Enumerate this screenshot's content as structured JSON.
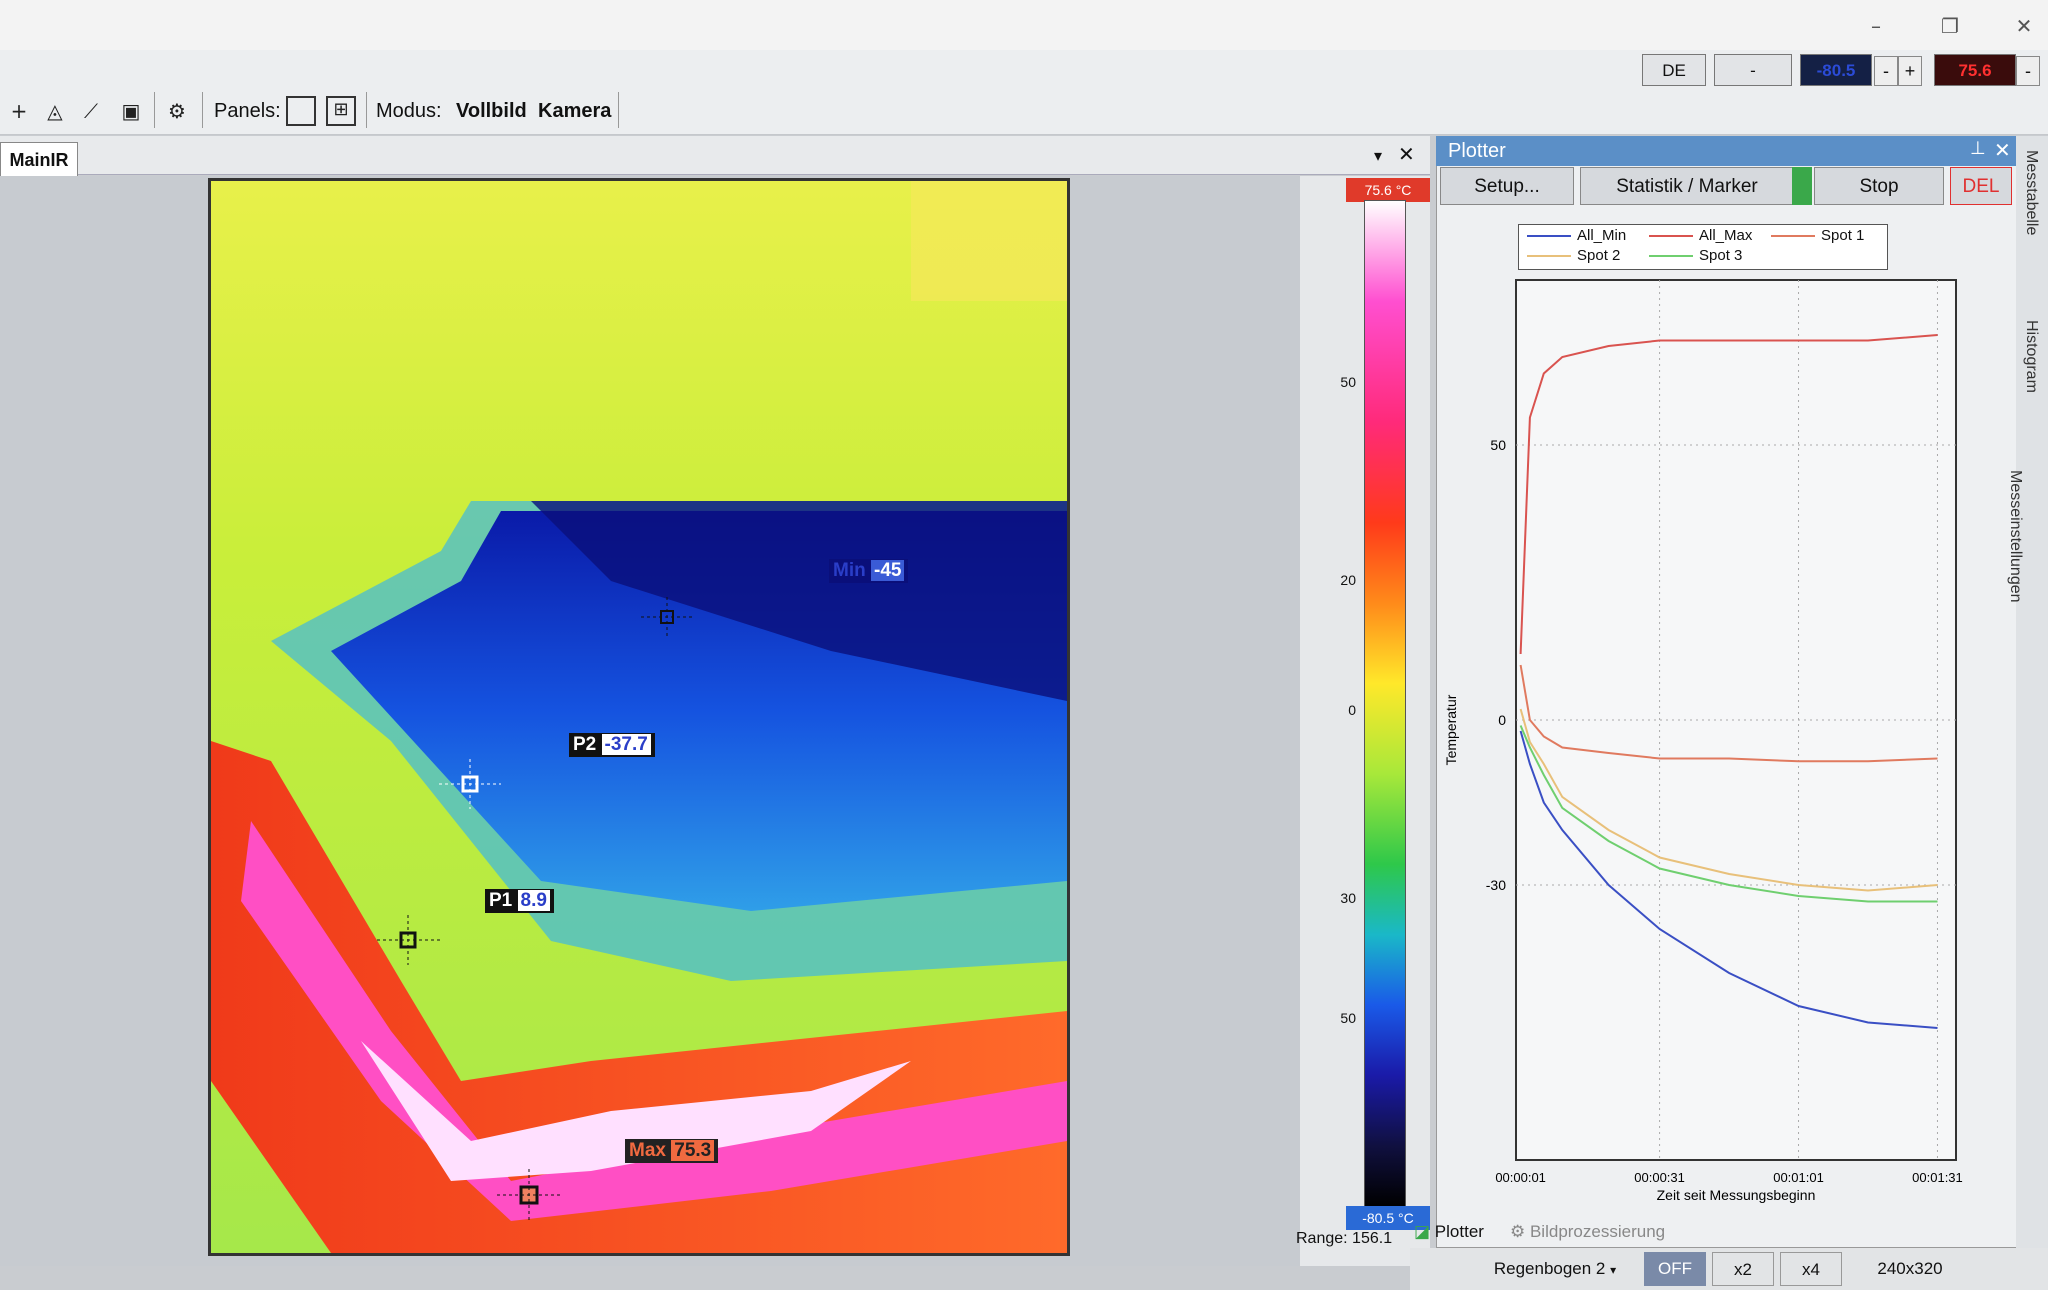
{
  "window": {
    "minimize": "–",
    "restore": "❐",
    "close": "✕"
  },
  "toolbar": {
    "panels_label": "Panels:",
    "modus_label": "Modus:",
    "modus_options": [
      "Vollbild",
      "Kamera"
    ],
    "lang": "DE",
    "dash": "-",
    "min_value": "-80.5",
    "max_value": "75.6",
    "minus": "-",
    "plus": "+"
  },
  "main_tab": {
    "label": "MainIR"
  },
  "markers": {
    "min": {
      "label": "Min",
      "value": "-45"
    },
    "p2": {
      "label": "P2",
      "value": "-37.7"
    },
    "p1": {
      "label": "P1",
      "value": "8.9"
    },
    "max": {
      "label": "Max",
      "value": "75.3"
    }
  },
  "scale": {
    "top_label": "75.6 °C",
    "bottom_label": "-80.5 °C",
    "range_label": "Range:",
    "range_value": "156.1",
    "ticks": [
      "50",
      "20",
      "0",
      "30",
      "50"
    ]
  },
  "plotter": {
    "title": "Plotter",
    "pin": "⊥",
    "close": "✕",
    "buttons": {
      "setup": "Setup...",
      "statistik": "Statistik / Marker",
      "stop": "Stop",
      "del": "DEL"
    },
    "tabs": {
      "plotter": "Plotter",
      "bildprozessierung": "Bildprozessierung"
    }
  },
  "chart_data": {
    "type": "line",
    "xlabel": "Zeit seit Messungsbeginn",
    "ylabel": "Temperatur",
    "x_ticks": [
      "00:00:01",
      "00:00:31",
      "00:01:01",
      "00:01:31"
    ],
    "y_ticks": [
      "50",
      "0",
      "-30"
    ],
    "x": [
      1,
      3,
      6,
      10,
      20,
      31,
      46,
      61,
      76,
      91
    ],
    "ylim": [
      -80,
      80
    ],
    "series": [
      {
        "name": "All_Min",
        "color": "#3a4fc4",
        "values": [
          -2,
          -8,
          -15,
          -20,
          -30,
          -38,
          -46,
          -52,
          -55,
          -56
        ]
      },
      {
        "name": "All_Max",
        "color": "#d9534f",
        "values": [
          12,
          55,
          63,
          66,
          68,
          69,
          69,
          69,
          69,
          70
        ]
      },
      {
        "name": "Spot 1",
        "color": "#e07a5f",
        "values": [
          10,
          0,
          -3,
          -5,
          -6,
          -7,
          -7,
          -7.5,
          -7.5,
          -7
        ]
      },
      {
        "name": "Spot 2",
        "color": "#e8c07a",
        "values": [
          2,
          -4,
          -8,
          -14,
          -20,
          -25,
          -28,
          -30,
          -31,
          -30
        ]
      },
      {
        "name": "Spot 3",
        "color": "#6fcf6f",
        "values": [
          -1,
          -5,
          -10,
          -16,
          -22,
          -27,
          -30,
          -32,
          -33,
          -33
        ]
      }
    ],
    "grid": true,
    "legend": "top"
  },
  "status": {
    "palette": "Regenbogen 2",
    "off": "OFF",
    "x2": "x2",
    "x4": "x4",
    "resolution": "240x320"
  },
  "sidebar": {
    "messtabelle": "Messtabelle",
    "histogram": "Histogram",
    "messeinstellungen": "Messeinstellungen"
  }
}
